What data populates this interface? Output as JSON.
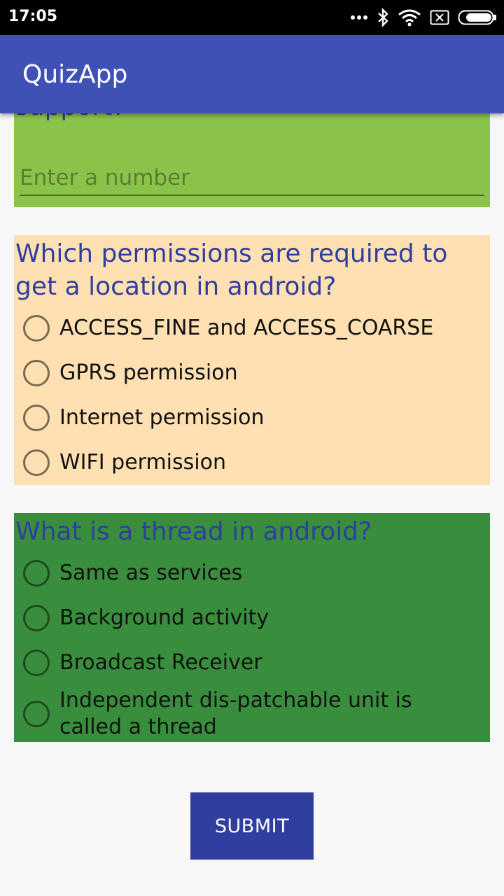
{
  "status_bar": {
    "time": "17:05",
    "icons": [
      "more-dots-icon",
      "bluetooth-icon",
      "wifi-icon",
      "no-sim-icon",
      "battery-icon"
    ]
  },
  "app_bar": {
    "title": "QuizApp"
  },
  "colors": {
    "primary": "#3f51b5",
    "primary_dark": "#303f9f",
    "card_light_green": "#8bc34a",
    "card_peach": "#ffe0b2",
    "card_dark_green": "#388e3c"
  },
  "question1": {
    "partial_text": "support?",
    "input_placeholder": "Enter a number",
    "input_value": ""
  },
  "question2": {
    "text": "Which permissions are required to get a location in android?",
    "options": [
      "ACCESS_FINE and ACCESS_COARSE",
      "GPRS permission",
      "Internet permission",
      "WIFI permission"
    ]
  },
  "question3": {
    "text": "What is a thread in android?",
    "options": [
      "Same as services",
      "Background activity",
      "Broadcast Receiver",
      "Independent dis-patchable unit is called a thread"
    ]
  },
  "submit": {
    "label": "SUBMIT"
  }
}
